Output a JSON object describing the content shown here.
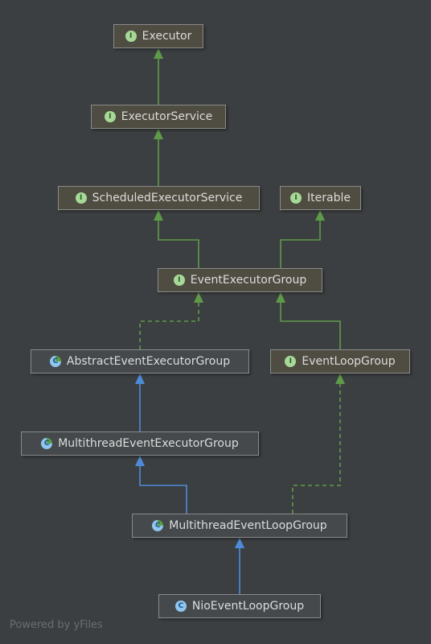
{
  "nodes": {
    "executor": {
      "label": "Executor",
      "kind": "interface"
    },
    "executor_service": {
      "label": "ExecutorService",
      "kind": "interface"
    },
    "scheduled_executor_service": {
      "label": "ScheduledExecutorService",
      "kind": "interface"
    },
    "iterable": {
      "label": "Iterable",
      "kind": "interface"
    },
    "event_executor_group": {
      "label": "EventExecutorGroup",
      "kind": "interface"
    },
    "abstract_event_executor_group": {
      "label": "AbstractEventExecutorGroup",
      "kind": "abstract-class"
    },
    "event_loop_group": {
      "label": "EventLoopGroup",
      "kind": "interface"
    },
    "multithread_event_executor_group": {
      "label": "MultithreadEventExecutorGroup",
      "kind": "abstract-class"
    },
    "multithread_event_loop_group": {
      "label": "MultithreadEventLoopGroup",
      "kind": "abstract-class"
    },
    "nio_event_loop_group": {
      "label": "NioEventLoopGroup",
      "kind": "class"
    }
  },
  "badges": {
    "interface": "I",
    "class": "C"
  },
  "edges": [
    {
      "from": "executor_service",
      "to": "executor",
      "type": "extends"
    },
    {
      "from": "scheduled_executor_service",
      "to": "executor_service",
      "type": "extends"
    },
    {
      "from": "event_executor_group",
      "to": "scheduled_executor_service",
      "type": "extends"
    },
    {
      "from": "event_executor_group",
      "to": "iterable",
      "type": "extends"
    },
    {
      "from": "abstract_event_executor_group",
      "to": "event_executor_group",
      "type": "implements"
    },
    {
      "from": "event_loop_group",
      "to": "event_executor_group",
      "type": "extends"
    },
    {
      "from": "multithread_event_executor_group",
      "to": "abstract_event_executor_group",
      "type": "class-extends"
    },
    {
      "from": "multithread_event_loop_group",
      "to": "multithread_event_executor_group",
      "type": "class-extends"
    },
    {
      "from": "multithread_event_loop_group",
      "to": "event_loop_group",
      "type": "implements"
    },
    {
      "from": "nio_event_loop_group",
      "to": "multithread_event_loop_group",
      "type": "class-extends"
    }
  ],
  "colors": {
    "interface_edge": "#5f9a49",
    "class_edge": "#4d8bd8",
    "background": "#3c3f41"
  },
  "footer": {
    "text": "Powered by yFiles"
  }
}
